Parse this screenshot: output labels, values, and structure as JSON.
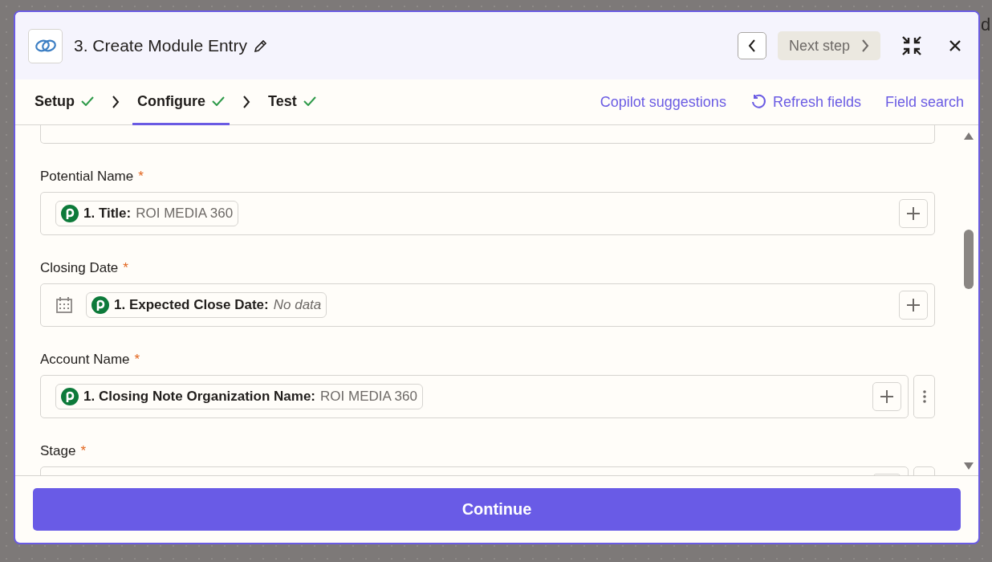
{
  "background": {
    "edge_text": "d"
  },
  "header": {
    "title": "3. Create Module Entry",
    "next_button": {
      "label": "Next step",
      "disabled": true
    }
  },
  "steps": [
    {
      "label": "Setup",
      "done": true,
      "selected": false
    },
    {
      "label": "Configure",
      "done": true,
      "selected": true
    },
    {
      "label": "Test",
      "done": true,
      "selected": false
    }
  ],
  "actions": [
    {
      "label": "Copilot suggestions",
      "kind": "link"
    },
    {
      "label": "Refresh fields",
      "kind": "refresh"
    },
    {
      "label": "Field search",
      "kind": "link"
    }
  ],
  "fields": [
    {
      "label": "Potential Name",
      "required": "*",
      "kind": "text",
      "has_menu": false,
      "chips": [
        {
          "label": "1. Title:",
          "value": "ROI MEDIA 360",
          "empty": false
        }
      ]
    },
    {
      "label": "Closing Date",
      "required": "*",
      "kind": "date",
      "has_menu": false,
      "chips": [
        {
          "label": "1. Expected Close Date:",
          "value": "No data",
          "empty": true
        }
      ]
    },
    {
      "label": "Account Name",
      "required": "*",
      "kind": "text",
      "has_menu": true,
      "chips": [
        {
          "label": "1. Closing Note Organization Name:",
          "value": "ROI MEDIA 360",
          "empty": false
        }
      ]
    },
    {
      "label": "Stage",
      "required": "*",
      "kind": "text",
      "has_menu": true
    }
  ],
  "footer": {
    "button": "Continue"
  }
}
